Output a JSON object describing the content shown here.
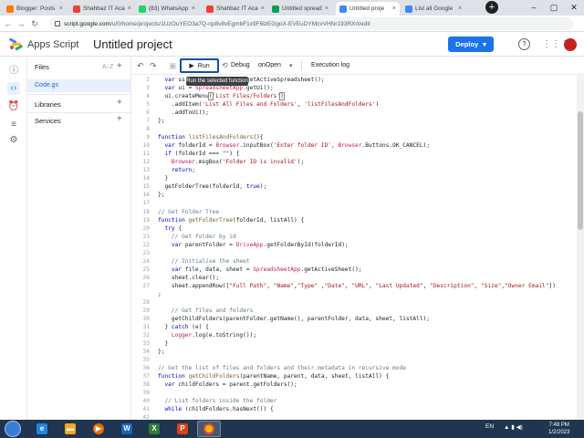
{
  "browser": {
    "tabs": [
      {
        "title": "Blogger: Posts",
        "color": "#f57c00",
        "active": false
      },
      {
        "title": "Shahbaz IT Aca",
        "color": "#ea4335",
        "active": false
      },
      {
        "title": "(83) WhatsApp",
        "color": "#25d366",
        "active": false
      },
      {
        "title": "Shahbaz IT Aca",
        "color": "#ea4335",
        "active": false
      },
      {
        "title": "Untitled spread",
        "color": "#0f9d58",
        "active": false
      },
      {
        "title": "Untitled proje",
        "color": "#4285f4",
        "active": true
      },
      {
        "title": "List all Google",
        "color": "#4285f4",
        "active": false
      }
    ],
    "new_tab": "+",
    "url_host": "script.google.com",
    "url_path": "/u/0/home/projects/1UzOuYEO3a7Q-np8v8vEgmbF1x9F6lzEGgoX-EVEuDYMcvVHNr193RXrt/edit"
  },
  "header": {
    "app_name": "Apps Script",
    "project_name": "Untitled project",
    "deploy_label": "Deploy",
    "deploy_caret": "▾"
  },
  "files_panel": {
    "files_label": "Files",
    "sort_label": "A↓Z",
    "add_symbol": "+",
    "file_name": "Code.gs",
    "libraries_label": "Libraries",
    "services_label": "Services"
  },
  "toolbar": {
    "run_label": "Run",
    "debug_label": "Debug",
    "function_select": "onOpen",
    "execution_log_label": "Execution log",
    "tooltip": "Run the selected function"
  },
  "editor": {
    "lines": [
      {
        "n": "2",
        "html": "  <span class='kw'>var</span> ss = <span class='cl'>SpreadsheetApp</span>.getActiveSpreadsheet();"
      },
      {
        "n": "3",
        "html": "  <span class='kw'>var</span> ui = <span class='cl'>SpreadsheetApp</span>.getUi();"
      },
      {
        "n": "4",
        "html": "  ui.createMenu<span class='hl'>(</span><span class='st'>'List Files/Folders'</span><span class='hl'>)</span>"
      },
      {
        "n": "5",
        "html": "    .addItem(<span class='st'>'List All Files and Folders'</span>, <span class='st'>'listFilesAndFolders'</span>)"
      },
      {
        "n": "6",
        "html": "    .addToUi();"
      },
      {
        "n": "7",
        "html": "};"
      },
      {
        "n": "8",
        "html": ""
      },
      {
        "n": "9",
        "html": "<span class='kw'>function</span> <span class='fn'>listFilesAndFolders</span>(){"
      },
      {
        "n": "10",
        "html": "  <span class='kw'>var</span> folderId = <span class='cl'>Browser</span>.inputBox(<span class='st'>'Enter folder ID'</span>, <span class='cl'>Browser</span>.Buttons.OK_CANCEL);"
      },
      {
        "n": "11",
        "html": "  <span class='kw'>if</span> (folderId === <span class='st'>\"\"</span>) {"
      },
      {
        "n": "12",
        "html": "    <span class='cl'>Browser</span>.msgBox(<span class='st'>'Folder ID is invalid'</span>);"
      },
      {
        "n": "13",
        "html": "    <span class='kw'>return</span>;"
      },
      {
        "n": "14",
        "html": "  }"
      },
      {
        "n": "15",
        "html": "  getFolderTree(folderId, <span class='kw'>true</span>);"
      },
      {
        "n": "16",
        "html": "};"
      },
      {
        "n": "17",
        "html": ""
      },
      {
        "n": "18",
        "html": "<span class='cm'>// Get Folder Tree</span>"
      },
      {
        "n": "19",
        "html": "<span class='kw'>function</span> <span class='fn'>getFolderTree</span>(folderId, listAll) {"
      },
      {
        "n": "20",
        "html": "  <span class='kw'>try</span> {"
      },
      {
        "n": "21",
        "html": "    <span class='cm'>// Get folder by id</span>"
      },
      {
        "n": "22",
        "html": "    <span class='kw'>var</span> parentFolder = <span class='cl'>DriveApp</span>.getFolderById(folderId);"
      },
      {
        "n": "23",
        "html": ""
      },
      {
        "n": "24",
        "html": "    <span class='cm'>// Initialise the sheet</span>"
      },
      {
        "n": "25",
        "html": "    <span class='kw'>var</span> file, data, sheet = <span class='cl'>SpreadsheetApp</span>.getActiveSheet();"
      },
      {
        "n": "26",
        "html": "    sheet.clear();"
      },
      {
        "n": "27",
        "html": "    sheet.appendRow([<span class='st'>\"Full Path\"</span>, <span class='st'>\"Name\"</span>,<span class='st'>\"Type\"</span> ,<span class='st'>\"Date\"</span>, <span class='st'>\"URL\"</span>, <span class='st'>\"Last Updated\"</span>, <span class='st'>\"Description\"</span>, <span class='st'>\"Size\"</span>,<span class='st'>\"Owner Email\"</span>])"
      },
      {
        "n": "",
        "html": ";"
      },
      {
        "n": "28",
        "html": ""
      },
      {
        "n": "29",
        "html": "    <span class='cm'>// Get files and folders</span>"
      },
      {
        "n": "30",
        "html": "    getChildFolders(parentFolder.getName(), parentFolder, data, sheet, listAll);"
      },
      {
        "n": "31",
        "html": "  } <span class='kw'>catch</span> (e) {"
      },
      {
        "n": "32",
        "html": "    <span class='cl'>Logger</span>.log(e.toString());"
      },
      {
        "n": "33",
        "html": "  }"
      },
      {
        "n": "34",
        "html": "};"
      },
      {
        "n": "35",
        "html": ""
      },
      {
        "n": "36",
        "html": "<span class='cm'>// Get the list of files and folders and their metadata in recursive mode</span>"
      },
      {
        "n": "37",
        "html": "<span class='kw'>function</span> <span class='fn'>getChildFolders</span>(parentName, parent, data, sheet, listAll) {"
      },
      {
        "n": "38",
        "html": "  <span class='kw'>var</span> childFolders = parent.getFolders();"
      },
      {
        "n": "39",
        "html": ""
      },
      {
        "n": "40",
        "html": "  <span class='cm'>// List folders inside the folder</span>"
      },
      {
        "n": "41",
        "html": "  <span class='kw'>while</span> (childFolders.hasNext()) {"
      },
      {
        "n": "42",
        "html": ""
      },
      {
        "n": "43",
        "html": "    <span class='kw'>var</span> childFolder = childFolders.next();"
      },
      {
        "n": "44",
        "html": "    <span class='kw'>var</span> folderId = childFolder.getId();"
      }
    ]
  },
  "taskbar": {
    "language": "EN",
    "time": "7:48 PM",
    "date": "1/2/2023"
  }
}
